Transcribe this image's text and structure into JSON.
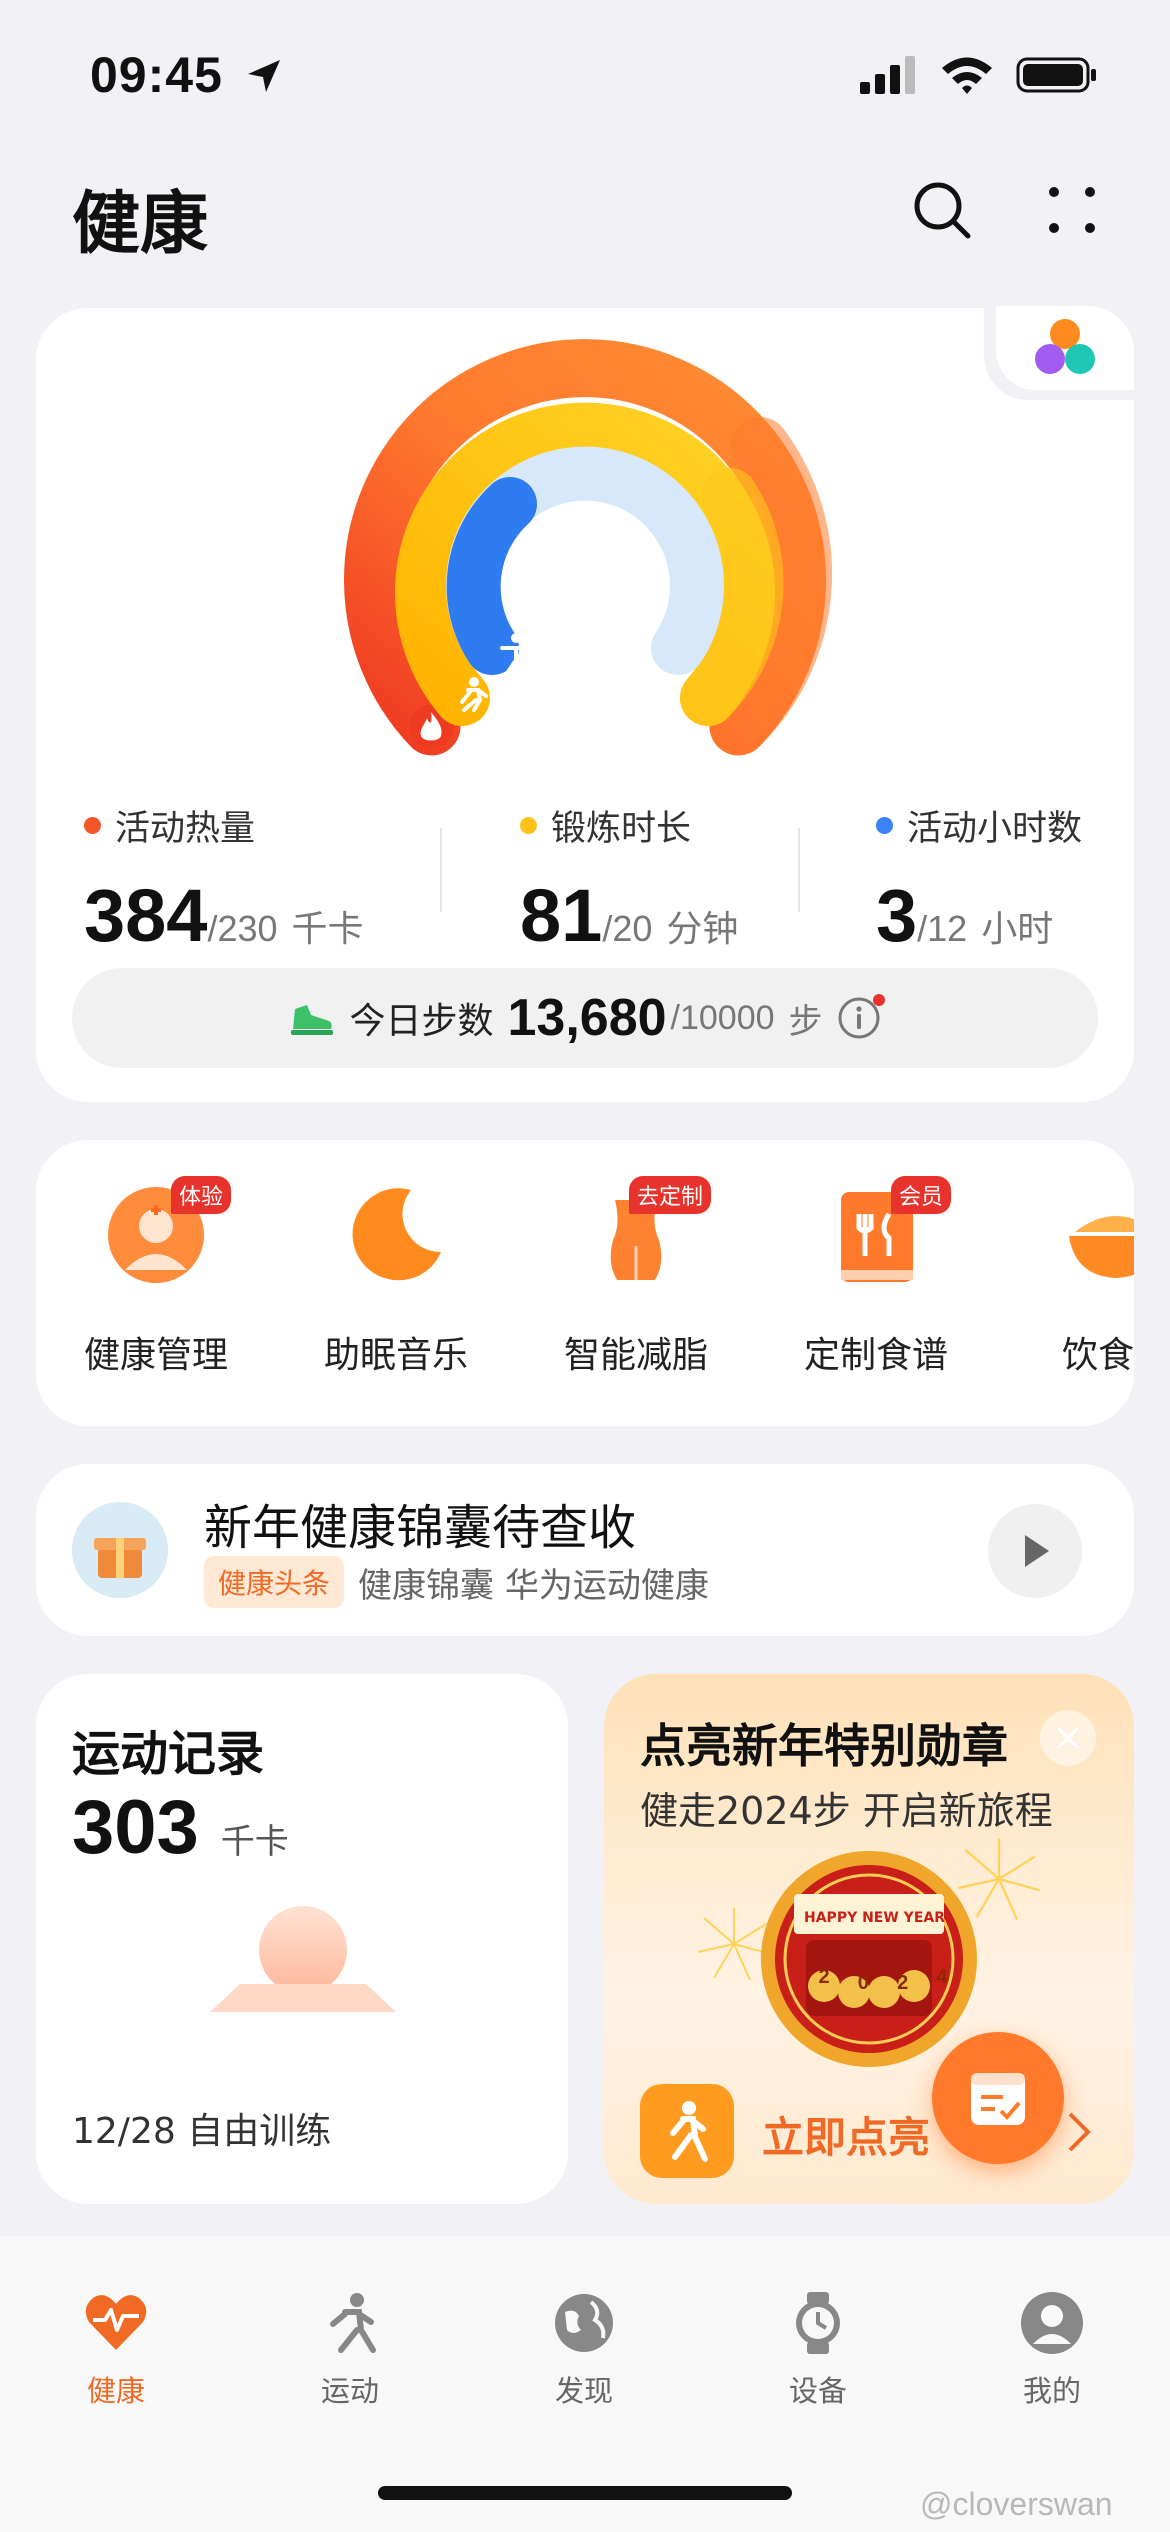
{
  "status_bar": {
    "time": "09:45"
  },
  "header": {
    "title": "健康"
  },
  "rings": {
    "colors": {
      "calories": "#f5552a",
      "exercise": "#ffc21a",
      "hours": "#3b82f6"
    },
    "calories": {
      "label": "活动热量",
      "value": "384",
      "goal": "/230",
      "unit": "千卡"
    },
    "exercise": {
      "label": "锻炼时长",
      "value": "81",
      "goal": "/20",
      "unit": "分钟"
    },
    "hours": {
      "label": "活动小时数",
      "value": "3",
      "goal": "/12",
      "unit": "小时"
    }
  },
  "steps": {
    "label": "今日步数",
    "value": "13,680",
    "goal": "/10000",
    "unit": "步"
  },
  "shortcuts": [
    {
      "label": "健康管理",
      "badge": "体验",
      "icon": "doctor-icon"
    },
    {
      "label": "助眠音乐",
      "badge": "",
      "icon": "moon-music-icon"
    },
    {
      "label": "智能减脂",
      "badge": "去定制",
      "icon": "body-shape-icon"
    },
    {
      "label": "定制食谱",
      "badge": "会员",
      "icon": "recipe-book-icon"
    },
    {
      "label": "饮食日",
      "badge": "",
      "icon": "food-bowl-icon"
    }
  ],
  "news": {
    "title": "新年健康锦囊待查收",
    "tag": "健康头条",
    "subtitle": "健康锦囊 华为运动健康"
  },
  "workout": {
    "title": "运动记录",
    "value": "303",
    "unit": "千卡",
    "entry": "12/28 自由训练"
  },
  "promo": {
    "title": "点亮新年特别勋章",
    "subtitle": "健走2024步 开启新旅程",
    "banner": "HAPPY NEW YEAR",
    "digits": [
      "2",
      "0",
      "2",
      "4"
    ],
    "cta": "立即点亮"
  },
  "bottom_nav": [
    {
      "label": "健康",
      "active": true
    },
    {
      "label": "运动",
      "active": false
    },
    {
      "label": "发现",
      "active": false
    },
    {
      "label": "设备",
      "active": false
    },
    {
      "label": "我的",
      "active": false
    }
  ],
  "watermark": "@cloverswan",
  "accent": "#f06a25"
}
